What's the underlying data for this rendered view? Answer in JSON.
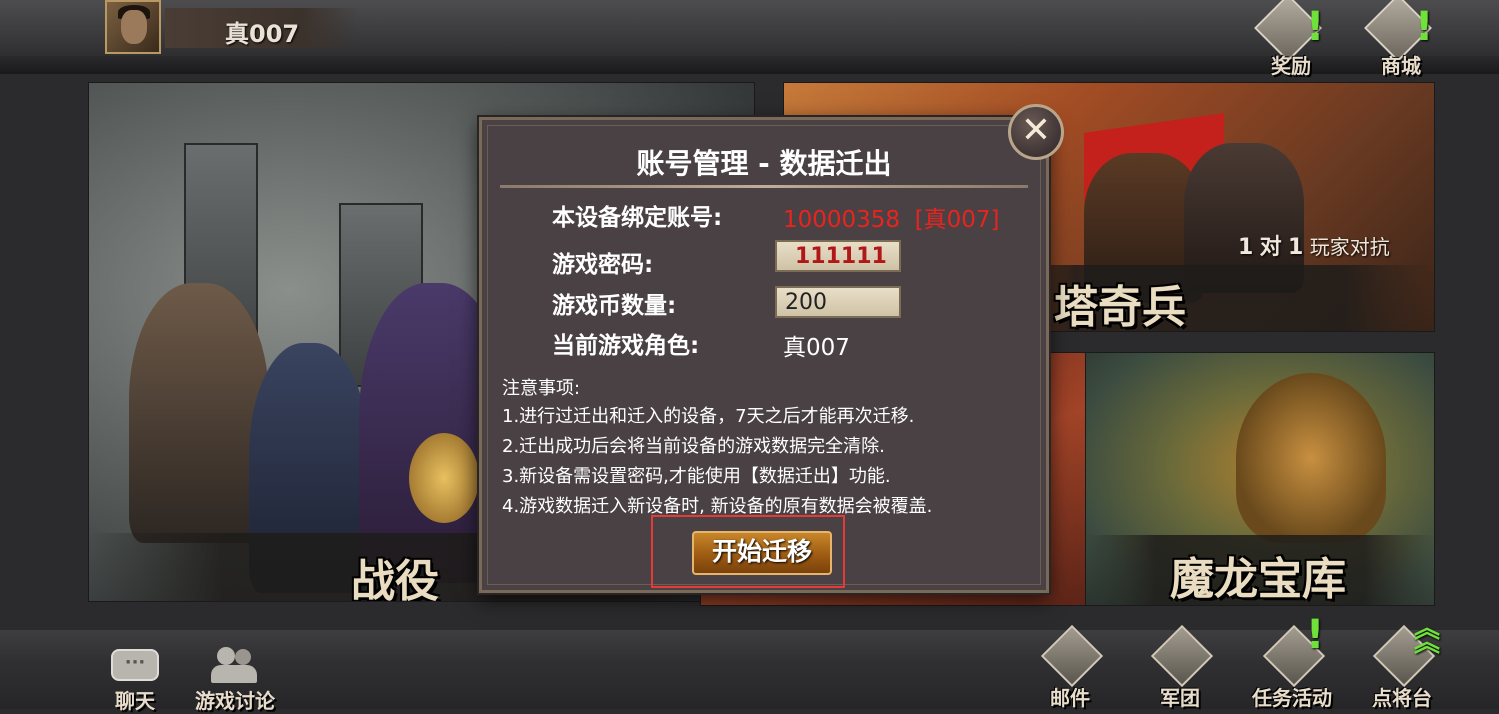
{
  "player": {
    "name": "真007"
  },
  "top_icons": [
    {
      "label": "奖励",
      "alert": "!"
    },
    {
      "label": "商城",
      "alert": "!"
    }
  ],
  "panels": {
    "campaign": "战役",
    "pvp_title": "塔奇兵",
    "pvp_subtitle_num1": "1",
    "pvp_subtitle_mid": "对",
    "pvp_subtitle_num2": "1",
    "pvp_subtitle_text": "玩家对抗",
    "dragon": "魔龙宝库"
  },
  "dialog": {
    "title": "账号管理 - 数据迁出",
    "close": "✕",
    "bound_label": "本设备绑定账号:",
    "bound_value": "10000358  [真007]",
    "password_label": "游戏密码:",
    "password_value": "111111",
    "coins_label": "游戏币数量:",
    "coins_value": "200",
    "role_label": "当前游戏角色:",
    "role_value": "真007",
    "notes_title": "注意事项:",
    "notes": [
      "1.进行过迁出和迁入的设备，7天之后才能再次迁移.",
      "2.迁出成功后会将当前设备的游戏数据完全清除.",
      "3.新设备需设置密码,才能使用【数据迁出】功能.",
      "4.游戏数据迁入新设备时, 新设备的原有数据会被覆盖."
    ],
    "start_button": "开始迁移"
  },
  "bottom_left": [
    {
      "label": "聊天"
    },
    {
      "label": "游戏讨论"
    }
  ],
  "bottom_right": [
    {
      "label": "邮件"
    },
    {
      "label": "军团"
    },
    {
      "label": "任务活动",
      "alert": "!"
    },
    {
      "label": "点将台"
    }
  ],
  "colors": {
    "alert_green": "#6fe23a",
    "value_red": "#e8241f",
    "highlight_box": "#e53a3a"
  }
}
